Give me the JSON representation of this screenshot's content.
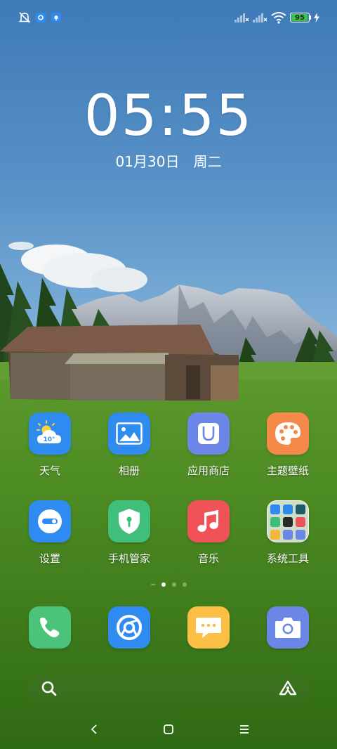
{
  "status_bar": {
    "battery_percent": "95",
    "battery_level": 0.95,
    "battery_color": "#3ec24f",
    "icons": [
      "mute-notification-icon",
      "app-notification-icon",
      "bell-notification-icon",
      "cell-signal-icon",
      "cell-signal-icon",
      "wifi-icon",
      "battery-icon",
      "charging-bolt-icon"
    ]
  },
  "clock": {
    "hours": "05",
    "separator": ":",
    "minutes": "55"
  },
  "date": {
    "day": "01月30日",
    "weekday": "周二"
  },
  "apps": [
    {
      "label": "天气",
      "icon": "weather-icon",
      "color": "#2f8bf0"
    },
    {
      "label": "相册",
      "icon": "gallery-icon",
      "color": "#2f8bf0"
    },
    {
      "label": "应用商店",
      "icon": "app-store-icon",
      "color": "#6b86e6"
    },
    {
      "label": "主题壁纸",
      "icon": "theme-palette-icon",
      "color": "#f5894a"
    },
    {
      "label": "设置",
      "icon": "settings-toggle-icon",
      "color": "#2f8bf0"
    },
    {
      "label": "手机管家",
      "icon": "security-shield-icon",
      "color": "#3fbf7a"
    },
    {
      "label": "音乐",
      "icon": "music-note-icon",
      "color": "#f0525a"
    },
    {
      "label": "系统工具",
      "icon": "folder-icon",
      "color": "#e8eee6"
    }
  ],
  "weather_icon_text": "10°",
  "folder_mini_colors": [
    "#2f8bf0",
    "#2a8ce8",
    "#1d5a6a",
    "#3fbf7a",
    "#2a2a2a",
    "#f0525a",
    "#f5b63a",
    "#6b86e6",
    "#6b86e6"
  ],
  "page_indicator": {
    "count": 4,
    "active_index": 1
  },
  "dock": [
    {
      "icon": "phone-icon",
      "color": "#4cc37b"
    },
    {
      "icon": "browser-icon",
      "color": "#2f8bf0"
    },
    {
      "icon": "messages-icon",
      "color": "#fbbf46"
    },
    {
      "icon": "camera-icon",
      "color": "#6b86e6"
    }
  ],
  "search_bar": {
    "left_icon": "search-icon",
    "right_icon": "assistant-icon"
  },
  "nav_bar": {
    "buttons": [
      "back-icon",
      "home-icon",
      "menu-icon"
    ]
  }
}
